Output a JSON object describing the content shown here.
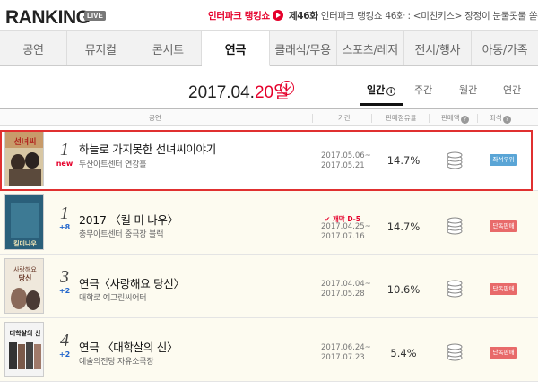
{
  "header": {
    "logo": "RANKING",
    "live_badge": "LIVE",
    "promo_brand": "인터파크 랭킹쇼",
    "promo_episode": "제46화",
    "promo_text": "인터파크 랭킹쇼 46화 : <미친키스> 장정이 눈물콧물 쏟은 사연"
  },
  "tabs": [
    {
      "label": "공연",
      "active": false
    },
    {
      "label": "뮤지컬",
      "active": false
    },
    {
      "label": "콘서트",
      "active": false
    },
    {
      "label": "연극",
      "active": true
    },
    {
      "label": "클래식/무용",
      "active": false
    },
    {
      "label": "스포츠/레저",
      "active": false
    },
    {
      "label": "전시/행사",
      "active": false
    },
    {
      "label": "아동/가족",
      "active": false
    }
  ],
  "date": {
    "prefix": "2017.04.",
    "day": "20일"
  },
  "periods": [
    "일간",
    "주간",
    "월간",
    "연간"
  ],
  "table_headers": {
    "show": "공연",
    "period": "기간",
    "share": "판매점유율",
    "sale_trend": "판매액",
    "rating": "좌석"
  },
  "rows": [
    {
      "rank": "1",
      "change": "new",
      "title": "하늘로 가지못한 선녀씨이야기",
      "venue": "두산아트센터 연강홀",
      "badge": "",
      "date_start": "2017.05.06~",
      "date_end": "2017.05.21",
      "share": "14.7%",
      "tag": "좌석우위",
      "tag_color": "#5aa5d6"
    },
    {
      "rank": "1",
      "change": "+8",
      "title": "2017 〈킬 미 나우〉",
      "venue": "충무아트센터 중극장 블랙",
      "badge": "개막 D-5",
      "date_start": "2017.04.25~",
      "date_end": "2017.07.16",
      "share": "14.7%",
      "tag": "단독판매",
      "tag_color": "#e86a6a"
    },
    {
      "rank": "3",
      "change": "+2",
      "title": "연극〈사랑해요 당신〉",
      "venue": "대학로 예그린씨어터",
      "badge": "",
      "date_start": "2017.04.04~",
      "date_end": "2017.05.28",
      "share": "10.6%",
      "tag": "단독판매",
      "tag_color": "#e86a6a"
    },
    {
      "rank": "4",
      "change": "+2",
      "title": "연극 〈대학살의 신〉",
      "venue": "예술의전당 자유소극장",
      "badge": "",
      "date_start": "2017.06.24~",
      "date_end": "2017.07.23",
      "share": "5.4%",
      "tag": "단독판매",
      "tag_color": "#e86a6a"
    }
  ],
  "colors": {
    "accent": "#e5002b",
    "highlight_border": "#e03030",
    "row_bg": "#fdfbf0"
  }
}
